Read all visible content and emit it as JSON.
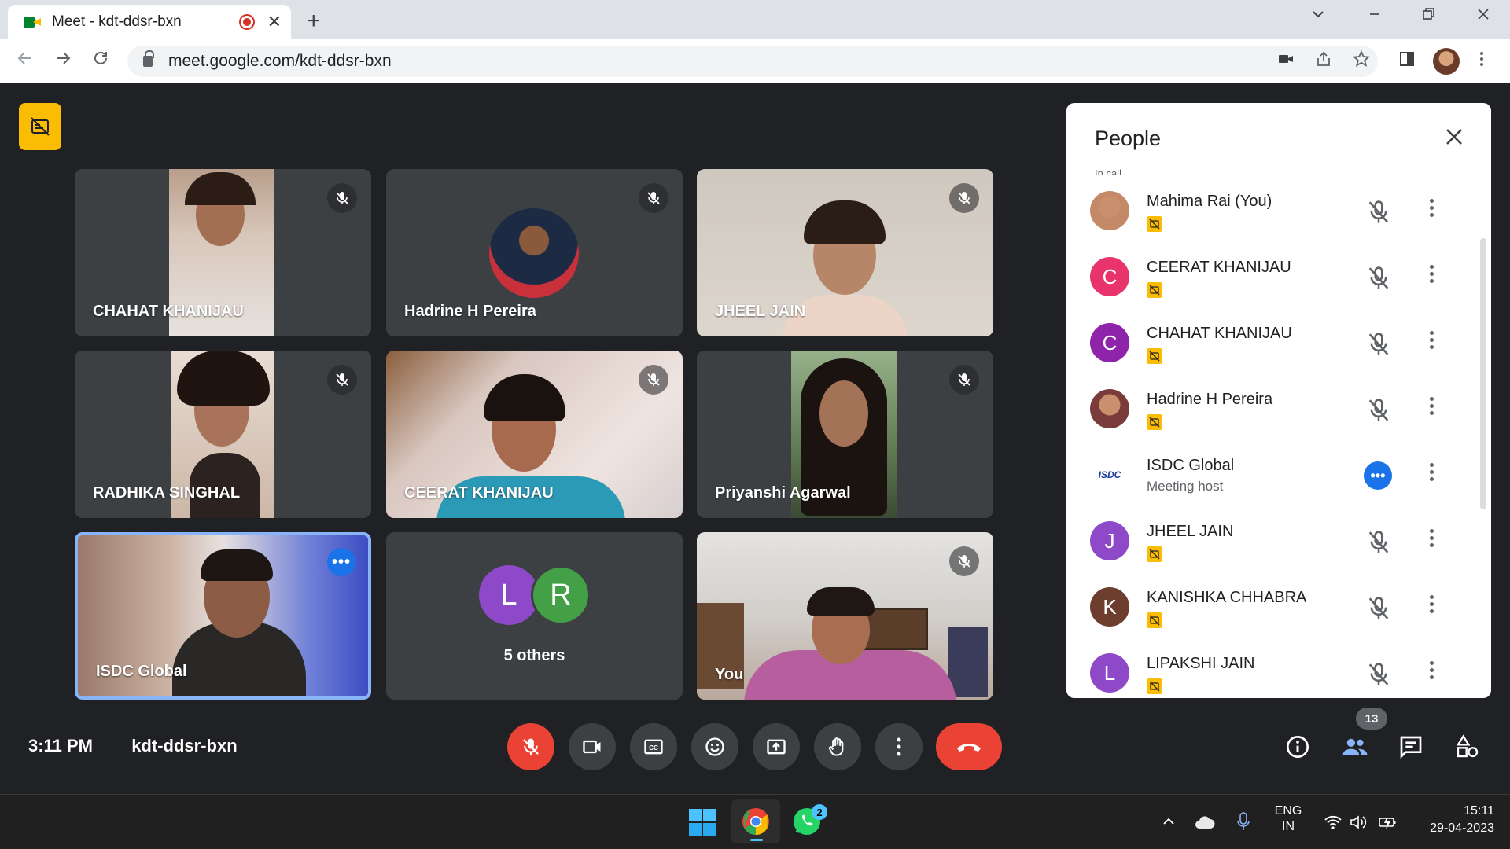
{
  "browser": {
    "tab_title": "Meet - kdt-ddsr-bxn",
    "url": "meet.google.com/kdt-ddsr-bxn",
    "new_tab_symbol": "+",
    "tab_close_symbol": "✕"
  },
  "tiles": [
    {
      "name": "CHAHAT KHANIJAU",
      "muted": true
    },
    {
      "name": "Hadrine H Pereira",
      "muted": true
    },
    {
      "name": "JHEEL JAIN",
      "muted": true
    },
    {
      "name": "RADHIKA SINGHAL",
      "muted": true
    },
    {
      "name": "CEERAT KHANIJAU",
      "muted": true
    },
    {
      "name": "Priyanshi Agarwal",
      "muted": true
    },
    {
      "name": "ISDC Global",
      "muted": false,
      "speaking": true
    },
    {
      "name": "5 others",
      "avatars": [
        "L",
        "R"
      ]
    },
    {
      "name": "You",
      "muted": true
    }
  ],
  "bottom_bar": {
    "time": "3:11 PM",
    "meeting_code": "kdt-ddsr-bxn",
    "participants_count": "13"
  },
  "people_panel": {
    "title": "People",
    "section_label": "In call",
    "participants": [
      {
        "name": "Mahima Rai (You)",
        "initial": "",
        "color": "#c48a68",
        "muted": true
      },
      {
        "name": "CEERAT KHANIJAU",
        "initial": "C",
        "color": "#e8336d",
        "muted": true
      },
      {
        "name": "CHAHAT KHANIJAU",
        "initial": "C",
        "color": "#8e24aa",
        "muted": true
      },
      {
        "name": "Hadrine H Pereira",
        "initial": "",
        "color": "#7a3b3b",
        "muted": true
      },
      {
        "name": "ISDC Global",
        "subtitle": "Meeting host",
        "initial": "ISDC",
        "color": "#ffffff",
        "muted": false
      },
      {
        "name": "JHEEL JAIN",
        "initial": "J",
        "color": "#8e49c8",
        "muted": true
      },
      {
        "name": "KANISHKA CHHABRA",
        "initial": "K",
        "color": "#6d3d2d",
        "muted": true
      },
      {
        "name": "LIPAKSHI JAIN",
        "initial": "L",
        "color": "#8e49c8",
        "muted": true
      }
    ]
  },
  "taskbar": {
    "whatsapp_badge": "2",
    "lang_top": "ENG",
    "lang_bottom": "IN",
    "clock_time": "15:11",
    "clock_date": "29-04-2023"
  },
  "colors": {
    "meet_bg": "#202124",
    "tile_bg": "#3c4043",
    "accent_red": "#ea4335",
    "accent_blue": "#1a73e8",
    "no_caption_yellow": "#fbbc04"
  }
}
